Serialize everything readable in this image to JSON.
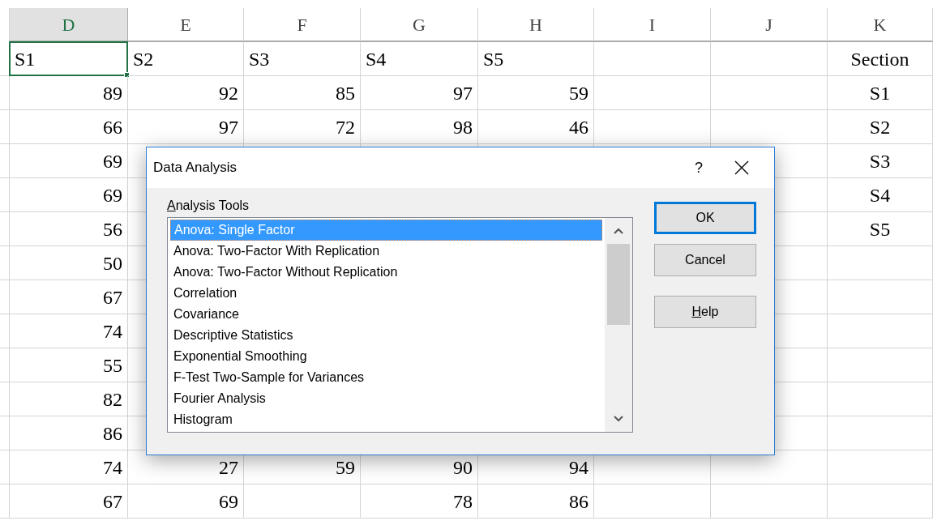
{
  "sheet": {
    "columns": [
      {
        "label": "D",
        "selected": true,
        "kind": "general"
      },
      {
        "label": "E",
        "selected": false,
        "kind": "general"
      },
      {
        "label": "F",
        "selected": false,
        "kind": "general"
      },
      {
        "label": "G",
        "selected": false,
        "kind": "general"
      },
      {
        "label": "H",
        "selected": false,
        "kind": "general"
      },
      {
        "label": "I",
        "selected": false,
        "kind": "general"
      },
      {
        "label": "J",
        "selected": false,
        "kind": "general"
      },
      {
        "label": "K",
        "selected": false,
        "kind": "centered"
      }
    ],
    "rows": [
      {
        "selected": true,
        "kind": "text",
        "cells": {
          "D": "S1",
          "E": "S2",
          "F": "S3",
          "G": "S4",
          "H": "S5",
          "K": "Section"
        }
      },
      {
        "selected": false,
        "kind": "number",
        "cells": {
          "D": "89",
          "E": "92",
          "F": "85",
          "G": "97",
          "H": "59",
          "K": "S1"
        }
      },
      {
        "selected": false,
        "kind": "number",
        "cells": {
          "D": "66",
          "E": "97",
          "F": "72",
          "G": "98",
          "H": "46",
          "K": "S2"
        }
      },
      {
        "selected": false,
        "kind": "number",
        "cells": {
          "D": "69",
          "K": "S3"
        }
      },
      {
        "selected": false,
        "kind": "number",
        "cells": {
          "D": "69",
          "K": "S4"
        }
      },
      {
        "selected": false,
        "kind": "number",
        "cells": {
          "D": "56",
          "K": "S5"
        }
      },
      {
        "selected": false,
        "kind": "number",
        "cells": {
          "D": "50"
        }
      },
      {
        "selected": false,
        "kind": "number",
        "cells": {
          "D": "67"
        }
      },
      {
        "selected": false,
        "kind": "number",
        "cells": {
          "D": "74"
        }
      },
      {
        "selected": false,
        "kind": "number",
        "cells": {
          "D": "55"
        }
      },
      {
        "selected": false,
        "kind": "number",
        "cells": {
          "D": "82"
        }
      },
      {
        "selected": false,
        "kind": "number",
        "cells": {
          "D": "86"
        }
      },
      {
        "selected": false,
        "kind": "number",
        "cells": {
          "D": "74",
          "E": "27",
          "F": "59",
          "G": "90",
          "H": "94"
        }
      },
      {
        "selected": false,
        "kind": "number",
        "cells": {
          "D": "67",
          "E": "69",
          "G": "78",
          "H": "86"
        }
      }
    ]
  },
  "dialog": {
    "title": "Data Analysis",
    "help": "?",
    "list_label": {
      "text": "Analysis Tools",
      "mnemonic": true
    },
    "tools": [
      {
        "label": "Anova: Single Factor",
        "selected": true
      },
      {
        "label": "Anova: Two-Factor With Replication",
        "selected": false
      },
      {
        "label": "Anova: Two-Factor Without Replication",
        "selected": false
      },
      {
        "label": "Correlation",
        "selected": false
      },
      {
        "label": "Covariance",
        "selected": false
      },
      {
        "label": "Descriptive Statistics",
        "selected": false
      },
      {
        "label": "Exponential Smoothing",
        "selected": false
      },
      {
        "label": "F-Test Two-Sample for Variances",
        "selected": false
      },
      {
        "label": "Fourier Analysis",
        "selected": false
      },
      {
        "label": "Histogram",
        "selected": false
      }
    ],
    "buttons": [
      {
        "label": "OK",
        "default": true,
        "mnemonic": false
      },
      {
        "label": "Cancel",
        "default": false,
        "mnemonic": false
      },
      {
        "label": "Help",
        "default": false,
        "mnemonic": true
      }
    ]
  }
}
